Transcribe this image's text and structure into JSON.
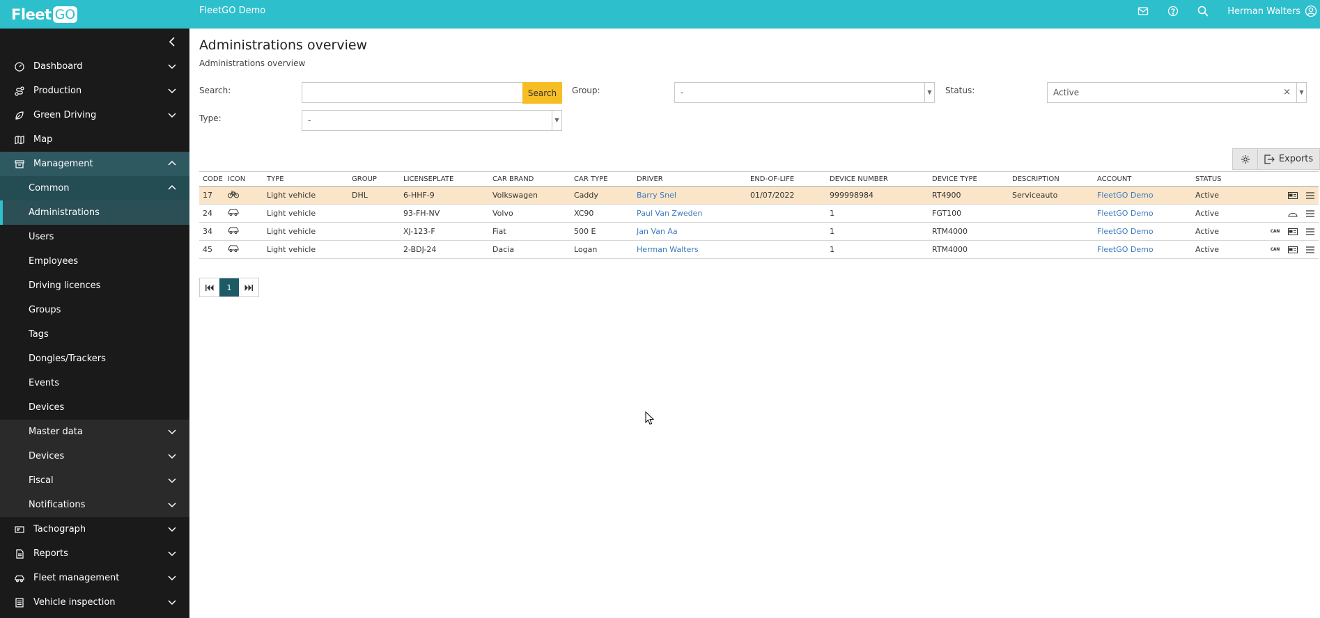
{
  "topbar": {
    "logo_text": "Fleet",
    "logo_badge": "GO",
    "app_name": "FleetGO Demo",
    "user_name": "Herman Walters"
  },
  "sidebar": {
    "items": [
      {
        "label": "Dashboard",
        "icon": "gauge-icon"
      },
      {
        "label": "Production",
        "icon": "route-icon"
      },
      {
        "label": "Green Driving",
        "icon": "leaf-icon"
      },
      {
        "label": "Map",
        "icon": "map-icon"
      },
      {
        "label": "Management",
        "icon": "archive-icon"
      }
    ],
    "common_label": "Common",
    "common_items": [
      "Administrations",
      "Users",
      "Employees",
      "Driving licences",
      "Groups",
      "Tags",
      "Dongles/Trackers",
      "Events",
      "Devices"
    ],
    "management_sub": [
      "Master data",
      "Devices",
      "Fiscal",
      "Notifications"
    ],
    "bottom_items": [
      {
        "label": "Tachograph",
        "icon": "tachograph-icon"
      },
      {
        "label": "Reports",
        "icon": "report-icon"
      },
      {
        "label": "Fleet management",
        "icon": "car-icon"
      },
      {
        "label": "Vehicle inspection",
        "icon": "checklist-icon"
      }
    ]
  },
  "page": {
    "title": "Administrations overview",
    "subtitle": "Administrations overview"
  },
  "filters": {
    "search_label": "Search:",
    "search_value": "",
    "search_button": "Search",
    "group_label": "Group:",
    "group_value": "-",
    "status_label": "Status:",
    "status_value": "Active",
    "type_label": "Type:",
    "type_value": "-"
  },
  "toolbar": {
    "exports_label": "Exports"
  },
  "table": {
    "headers": [
      "CODE",
      "ICON",
      "TYPE",
      "GROUP",
      "LICENSEPLATE",
      "CAR BRAND",
      "CAR TYPE",
      "DRIVER",
      "END-OF-LIFE",
      "DEVICE NUMBER",
      "DEVICE TYPE",
      "DESCRIPTION",
      "ACCOUNT",
      "STATUS"
    ],
    "rows": [
      {
        "code": "17",
        "icon": "bicycle-icon",
        "type": "Light vehicle",
        "group": "DHL",
        "plate": "6-HHF-9",
        "brand": "Volkswagen",
        "car_type": "Caddy",
        "driver": "Barry Snel",
        "eol": "01/07/2022",
        "device_number": "999998984",
        "device_type": "RT4900",
        "description": "Serviceauto",
        "account": "FleetGO Demo",
        "status": "Active",
        "can": ""
      },
      {
        "code": "24",
        "icon": "car-icon",
        "type": "Light vehicle",
        "group": "",
        "plate": "93-FH-NV",
        "brand": "Volvo",
        "car_type": "XC90",
        "driver": "Paul Van Zweden",
        "eol": "",
        "device_number": "1",
        "device_type": "FGT100",
        "description": "",
        "account": "FleetGO Demo",
        "status": "Active",
        "can": ""
      },
      {
        "code": "34",
        "icon": "car-icon",
        "type": "Light vehicle",
        "group": "",
        "plate": "XJ-123-F",
        "brand": "Fiat",
        "car_type": "500 E",
        "driver": "Jan Van Aa",
        "eol": "",
        "device_number": "1",
        "device_type": "RTM4000",
        "description": "",
        "account": "FleetGO Demo",
        "status": "Active",
        "can": "CAN"
      },
      {
        "code": "45",
        "icon": "car-icon",
        "type": "Light vehicle",
        "group": "",
        "plate": "2-BDJ-24",
        "brand": "Dacia",
        "car_type": "Logan",
        "driver": "Herman Walters",
        "eol": "",
        "device_number": "1",
        "device_type": "RTM4000",
        "description": "",
        "account": "FleetGO Demo",
        "status": "Active",
        "can": "CAN"
      }
    ]
  },
  "pager": {
    "current_page": "1"
  }
}
